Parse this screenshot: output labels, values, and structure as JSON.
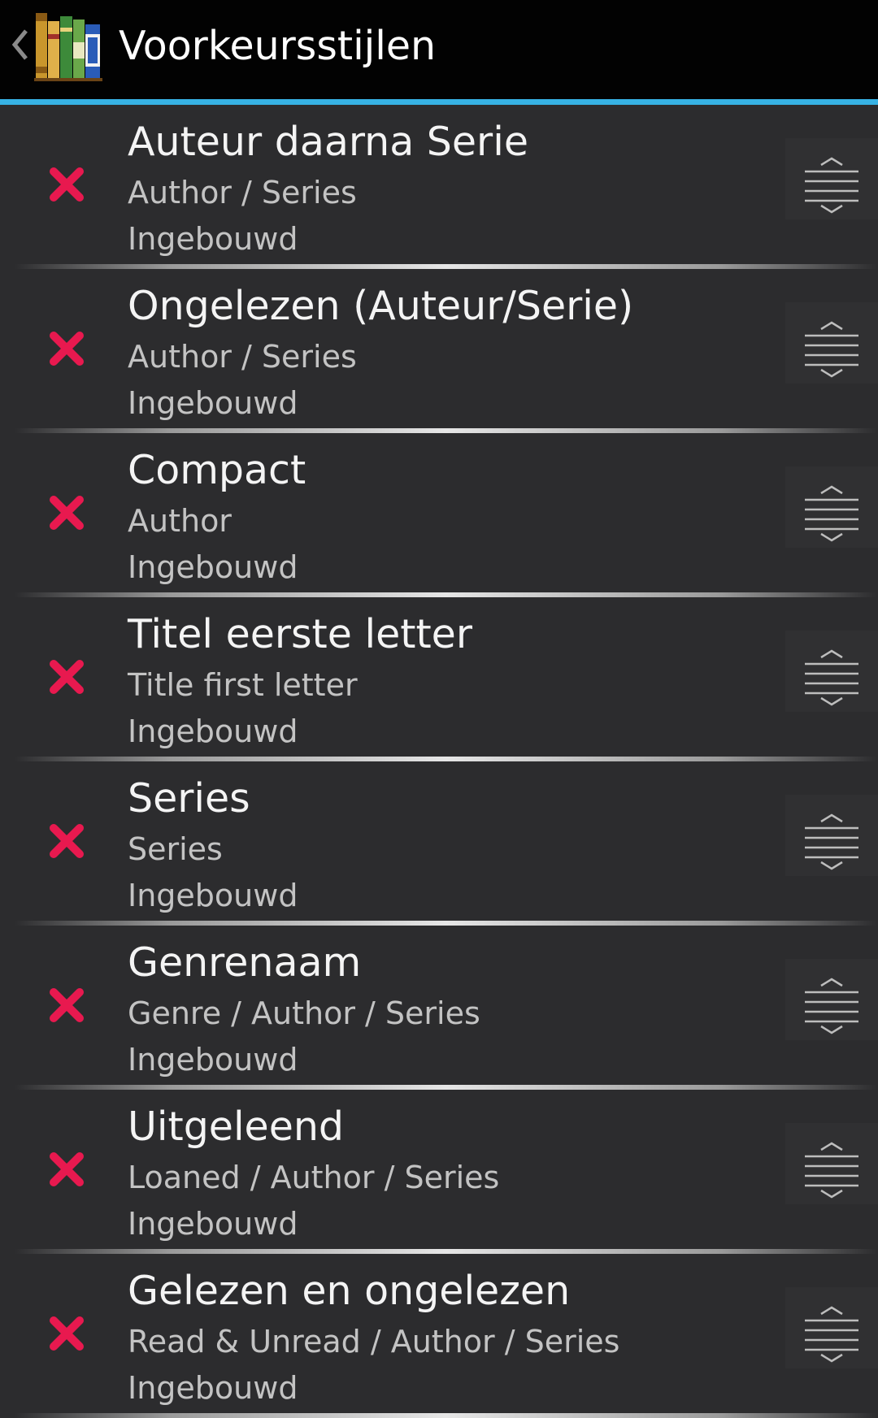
{
  "header": {
    "title": "Voorkeursstijlen",
    "back_icon": "chevron-left-icon",
    "logo_icon": "bookshelf-logo"
  },
  "colors": {
    "accent_line": "#37b2e4",
    "delete": "#e8194f",
    "background": "#2c2c2e",
    "actionbar": "#020202"
  },
  "styles": [
    {
      "title": "Auteur daarna Serie",
      "groups": "Author / Series",
      "kind": "Ingebouwd"
    },
    {
      "title": "Ongelezen (Auteur/Serie)",
      "groups": "Author / Series",
      "kind": "Ingebouwd"
    },
    {
      "title": "Compact",
      "groups": "Author",
      "kind": "Ingebouwd"
    },
    {
      "title": "Titel eerste letter",
      "groups": "Title first letter",
      "kind": "Ingebouwd"
    },
    {
      "title": "Series",
      "groups": "Series",
      "kind": "Ingebouwd"
    },
    {
      "title": "Genrenaam",
      "groups": "Genre / Author / Series",
      "kind": "Ingebouwd"
    },
    {
      "title": "Uitgeleend",
      "groups": "Loaned / Author / Series",
      "kind": "Ingebouwd"
    },
    {
      "title": "Gelezen en ongelezen",
      "groups": "Read & Unread / Author / Series",
      "kind": "Ingebouwd"
    }
  ]
}
